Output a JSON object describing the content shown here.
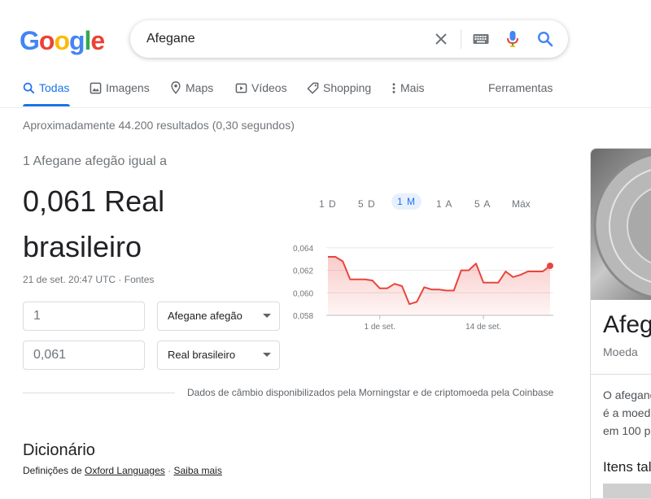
{
  "search": {
    "query": "Afegane"
  },
  "colors": {
    "accent": "#1a73e8",
    "chart_line": "#e8453c",
    "chart_fill": "#fce8e6"
  },
  "logo": {
    "letters": [
      "G",
      "o",
      "o",
      "g",
      "l",
      "e"
    ],
    "colors": [
      "#4285F4",
      "#EA4335",
      "#FBBC05",
      "#4285F4",
      "#34A853",
      "#EA4335"
    ]
  },
  "tabs": [
    {
      "label": "Todas",
      "icon": "search-icon",
      "active": true
    },
    {
      "label": "Imagens",
      "icon": "image-icon"
    },
    {
      "label": "Maps",
      "icon": "map-pin-icon"
    },
    {
      "label": "Vídeos",
      "icon": "video-icon"
    },
    {
      "label": "Shopping",
      "icon": "tag-icon"
    },
    {
      "label": "Mais",
      "icon": "more-vert-icon"
    }
  ],
  "tools_label": "Ferramentas",
  "stats": "Aproximadamente 44.200 resultados (0,30 segundos)",
  "converter": {
    "title": "1 Afegane afegão igual a",
    "result_line1": "0,061 Real",
    "result_line2": "brasileiro",
    "date": "21 de set. 20:47 UTC",
    "sources_label": "Fontes",
    "separator": " · ",
    "amount_from": "1",
    "amount_to": "0,061",
    "currency_from": "Afegane afegão",
    "currency_to": "Real brasileiro",
    "ranges": [
      "1 D",
      "5 D",
      "1 M",
      "1 A",
      "5 A",
      "Máx"
    ],
    "active_range": "1 M",
    "disclaimer": "Dados de câmbio disponibilizados pela Morningstar e de criptomoeda pela Coinbase"
  },
  "chart_data": {
    "type": "area",
    "y_ticks": [
      "0,064",
      "0,062",
      "0,060",
      "0,058"
    ],
    "ylim": [
      0.058,
      0.0645
    ],
    "x_ticks": [
      "1 de set.",
      "14 de set."
    ],
    "values": [
      0.0632,
      0.0632,
      0.0628,
      0.0612,
      0.0612,
      0.0612,
      0.0611,
      0.0604,
      0.0604,
      0.0608,
      0.0606,
      0.059,
      0.0592,
      0.0605,
      0.0603,
      0.0603,
      0.0602,
      0.0602,
      0.062,
      0.062,
      0.0626,
      0.0609,
      0.0609,
      0.0609,
      0.0619,
      0.0614,
      0.0616,
      0.0619,
      0.0619,
      0.0619,
      0.0624
    ],
    "x_tick_indices": [
      7,
      21
    ],
    "grid": true
  },
  "dictionary": {
    "title": "Dicionário",
    "prefix": "Definições de ",
    "source_link": "Oxford Languages",
    "separator": " · ",
    "more_link": "Saiba mais"
  },
  "knowledge_panel": {
    "title": "Afegane",
    "subtitle": "Moeda",
    "desc_lines": [
      "O afegane",
      "é a moeda",
      "em 100 p"
    ],
    "items_heading": "Itens tal"
  }
}
